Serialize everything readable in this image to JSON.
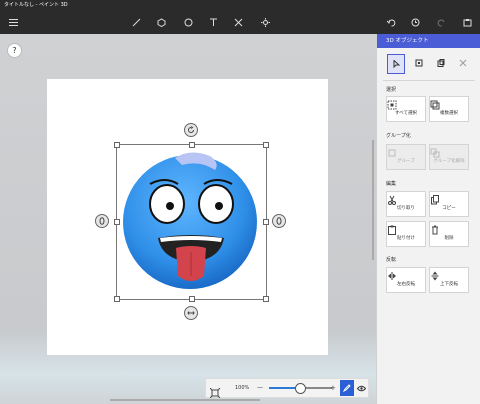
{
  "window": {
    "title": "タイトルなし - ペイント 3D"
  },
  "toolbar": {
    "icons": [
      "menu-icon",
      "brushes-icon",
      "3d-shapes-icon",
      "stickers-icon",
      "text-icon",
      "effects-icon",
      "light-icon",
      "undo-icon",
      "history-icon",
      "redo-icon",
      "paste-icon"
    ]
  },
  "canvas": {
    "help_label": "?",
    "zoom_label": "100%",
    "zoom_minus": "—",
    "zoom_plus": "+"
  },
  "panel": {
    "title": "3D オブジェクト",
    "sections": {
      "select": {
        "title": "選択",
        "buttons": [
          "すべて選択",
          "複数選択"
        ]
      },
      "group": {
        "title": "グループ化",
        "buttons": [
          "グループ",
          "グループ化解除"
        ]
      },
      "edit": {
        "title": "編集",
        "buttons": [
          "切り取り",
          "コピー",
          "貼り付け",
          "削除"
        ]
      },
      "flip": {
        "title": "反転",
        "buttons": [
          "左右反転",
          "上下反転"
        ]
      }
    }
  },
  "colors": {
    "accent": "#4a5cd6",
    "toolbar": "#2b2b2b",
    "emoji_blue": "#2f8fe8",
    "slider": "#2a7bd6"
  }
}
